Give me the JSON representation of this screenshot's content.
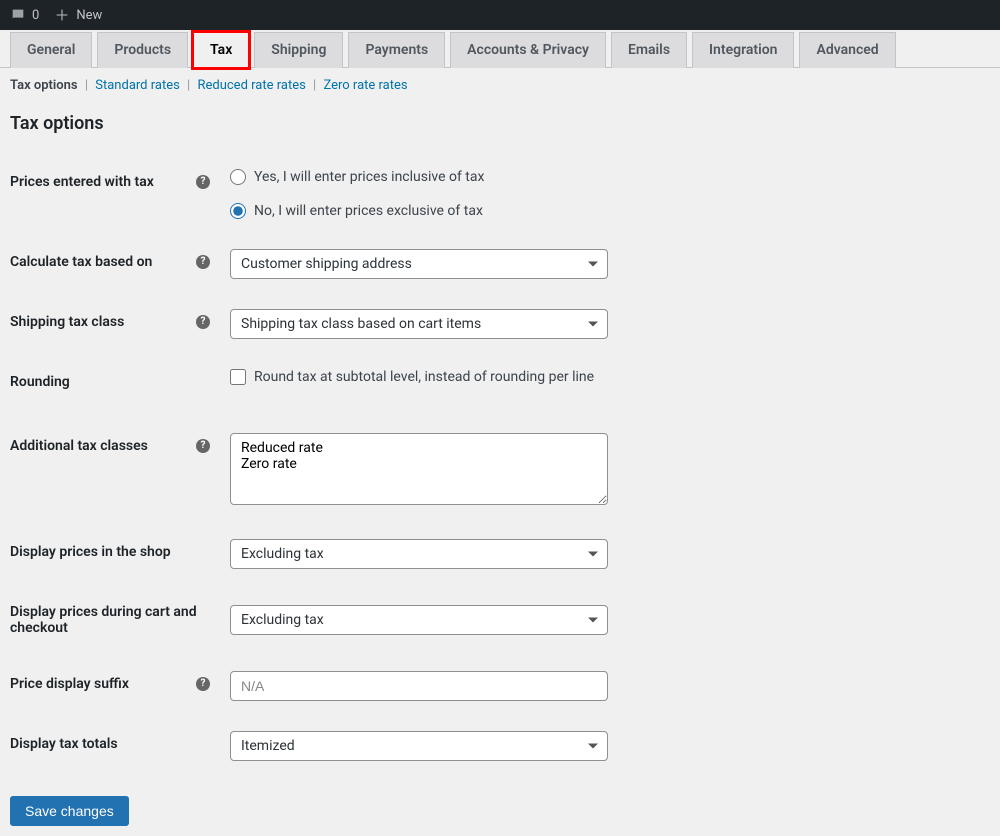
{
  "adminBar": {
    "comments": "0",
    "new": "New"
  },
  "tabs": [
    "General",
    "Products",
    "Tax",
    "Shipping",
    "Payments",
    "Accounts & Privacy",
    "Emails",
    "Integration",
    "Advanced"
  ],
  "subnav": {
    "taxOptions": "Tax options",
    "standardRates": "Standard rates",
    "reducedRates": "Reduced rate rates",
    "zeroRates": "Zero rate rates"
  },
  "pageTitle": "Tax options",
  "labels": {
    "pricesEnteredWithTax": "Prices entered with tax",
    "calculateTaxBasedOn": "Calculate tax based on",
    "shippingTaxClass": "Shipping tax class",
    "rounding": "Rounding",
    "additionalTaxClasses": "Additional tax classes",
    "displayPricesShop": "Display prices in the shop",
    "displayPricesCart": "Display prices during cart and checkout",
    "priceDisplaySuffix": "Price display suffix",
    "displayTaxTotals": "Display tax totals"
  },
  "options": {
    "pricesInclusive": "Yes, I will enter prices inclusive of tax",
    "pricesExclusive": "No, I will enter prices exclusive of tax",
    "calculateTaxValue": "Customer shipping address",
    "shippingTaxValue": "Shipping tax class based on cart items",
    "roundingLabel": "Round tax at subtotal level, instead of rounding per line",
    "additionalTaxClassesValue": "Reduced rate\nZero rate",
    "displayShopValue": "Excluding tax",
    "displayCartValue": "Excluding tax",
    "priceSuffixPlaceholder": "N/A",
    "displayTaxTotalsValue": "Itemized"
  },
  "saveButton": "Save changes"
}
